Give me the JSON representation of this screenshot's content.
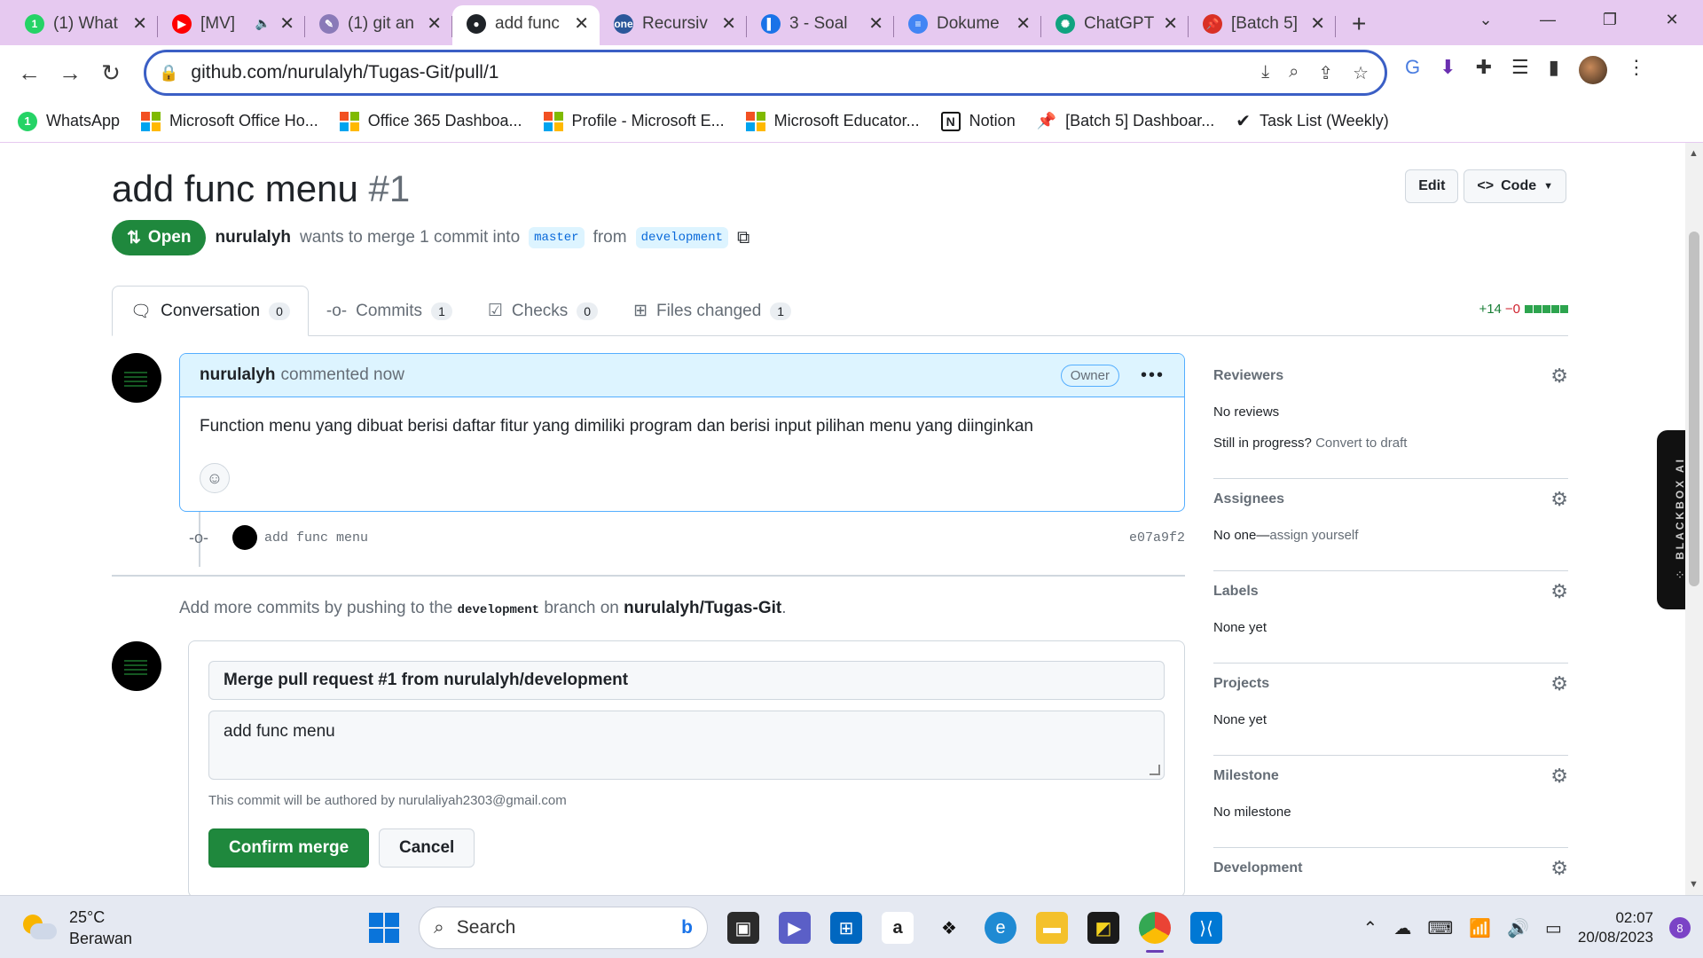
{
  "browser": {
    "tabs": [
      {
        "title": "(1) What",
        "favicon": "whatsapp-icon",
        "color": "#25d366",
        "glyph": "1"
      },
      {
        "title": "[MV]",
        "favicon": "youtube-icon",
        "color": "#ff0000",
        "glyph": "▶",
        "audio": "🔈"
      },
      {
        "title": "(1) git an",
        "favicon": "quill-icon",
        "color": "#8a7ab8",
        "glyph": "✎"
      },
      {
        "title": "add func",
        "favicon": "github-icon",
        "color": "#1f2328",
        "glyph": "●",
        "active": true
      },
      {
        "title": "Recursiv",
        "favicon": "onenote-icon",
        "color": "#2b579a",
        "glyph": "one"
      },
      {
        "title": "3 - Soal",
        "favicon": "document-icon",
        "color": "#1a73e8",
        "glyph": "▌"
      },
      {
        "title": "Dokume",
        "favicon": "docs-icon",
        "color": "#4285f4",
        "glyph": "≡"
      },
      {
        "title": "ChatGPT",
        "favicon": "chatgpt-icon",
        "color": "#10a37f",
        "glyph": "✺"
      },
      {
        "title": "[Batch 5]",
        "favicon": "pin-icon",
        "color": "#d93025",
        "glyph": "📌"
      }
    ],
    "new_tab_glyph": "+",
    "window_controls": {
      "menu": "⌄",
      "minimize": "—",
      "restore": "❐",
      "close": "✕"
    },
    "url": "github.com/nurulalyh/Tugas-Git/pull/1",
    "bookmarks": [
      {
        "label": "WhatsApp",
        "icon": "whatsapp-icon"
      },
      {
        "label": "Microsoft Office Ho...",
        "icon": "microsoft-icon"
      },
      {
        "label": "Office 365 Dashboa...",
        "icon": "microsoft-icon"
      },
      {
        "label": "Profile - Microsoft E...",
        "icon": "microsoft-icon"
      },
      {
        "label": "Microsoft Educator...",
        "icon": "microsoft-icon"
      },
      {
        "label": "Notion",
        "icon": "notion-icon"
      },
      {
        "label": "[Batch 5] Dashboar...",
        "icon": "pin-icon"
      },
      {
        "label": "Task List (Weekly)",
        "icon": "check-icon"
      }
    ]
  },
  "pr": {
    "title": "add func menu",
    "number": "#1",
    "edit_label": "Edit",
    "code_label": "Code",
    "state": "Open",
    "author": "nurulalyh",
    "merge_text": "wants to merge 1 commit into",
    "base_branch": "master",
    "from_text": "from",
    "head_branch": "development",
    "tabs": [
      {
        "label": "Conversation",
        "count": "0",
        "icon": "conversation-icon"
      },
      {
        "label": "Commits",
        "count": "1",
        "icon": "commit-icon"
      },
      {
        "label": "Checks",
        "count": "0",
        "icon": "checklist-icon"
      },
      {
        "label": "Files changed",
        "count": "1",
        "icon": "file-diff-icon"
      }
    ],
    "additions": "+14",
    "deletions": "−0"
  },
  "comment": {
    "author": "nurulalyh",
    "meta": "commented now",
    "badge": "Owner",
    "body": "Function menu yang dibuat berisi daftar fitur yang dimiliki program dan berisi input pilihan menu yang diinginkan"
  },
  "commit": {
    "message": "add func menu",
    "sha": "e07a9f2"
  },
  "push_hint": {
    "before": "Add more commits by pushing to the",
    "branch": "development",
    "middle": "branch on",
    "repo": "nurulalyh/Tugas-Git",
    "after": "."
  },
  "merge": {
    "title_value": "Merge pull request #1 from nurulalyh/development",
    "body_value": "add func menu",
    "note": "This commit will be authored by nurulaliyah2303@gmail.com",
    "confirm_label": "Confirm merge",
    "cancel_label": "Cancel"
  },
  "sidebar": {
    "reviewers": {
      "title": "Reviewers",
      "value": "No reviews",
      "progress_text": "Still in progress?",
      "draft_link": "Convert to draft"
    },
    "assignees": {
      "title": "Assignees",
      "value": "No one—",
      "assign_link": "assign yourself"
    },
    "labels": {
      "title": "Labels",
      "value": "None yet"
    },
    "projects": {
      "title": "Projects",
      "value": "None yet"
    },
    "milestone": {
      "title": "Milestone",
      "value": "No milestone"
    },
    "development": {
      "title": "Development"
    }
  },
  "blackbox": {
    "label": "BLACKBOX AI"
  },
  "taskbar": {
    "temp": "25°C",
    "condition": "Berawan",
    "search_label": "Search",
    "time": "02:07",
    "date": "20/08/2023",
    "notifications": "8"
  }
}
